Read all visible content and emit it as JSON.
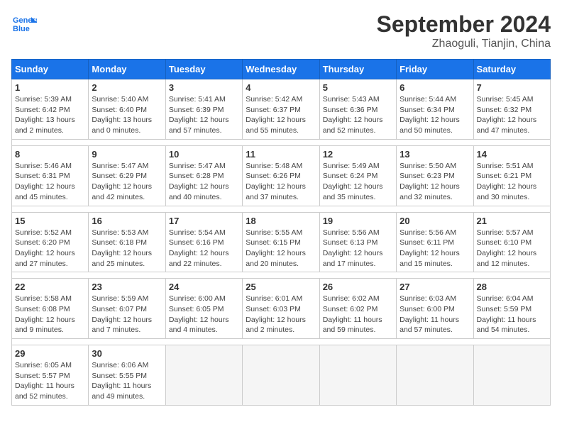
{
  "logo": {
    "line1": "General",
    "line2": "Blue"
  },
  "title": "September 2024",
  "subtitle": "Zhaoguli, Tianjin, China",
  "weekdays": [
    "Sunday",
    "Monday",
    "Tuesday",
    "Wednesday",
    "Thursday",
    "Friday",
    "Saturday"
  ],
  "weeks": [
    [
      {
        "day": "1",
        "rise": "5:39 AM",
        "set": "6:42 PM",
        "hours": "13 hours",
        "mins": "2 minutes"
      },
      {
        "day": "2",
        "rise": "5:40 AM",
        "set": "6:40 PM",
        "hours": "13 hours",
        "mins": "0 minutes"
      },
      {
        "day": "3",
        "rise": "5:41 AM",
        "set": "6:39 PM",
        "hours": "12 hours",
        "mins": "57 minutes"
      },
      {
        "day": "4",
        "rise": "5:42 AM",
        "set": "6:37 PM",
        "hours": "12 hours",
        "mins": "55 minutes"
      },
      {
        "day": "5",
        "rise": "5:43 AM",
        "set": "6:36 PM",
        "hours": "12 hours",
        "mins": "52 minutes"
      },
      {
        "day": "6",
        "rise": "5:44 AM",
        "set": "6:34 PM",
        "hours": "12 hours",
        "mins": "50 minutes"
      },
      {
        "day": "7",
        "rise": "5:45 AM",
        "set": "6:32 PM",
        "hours": "12 hours",
        "mins": "47 minutes"
      }
    ],
    [
      {
        "day": "8",
        "rise": "5:46 AM",
        "set": "6:31 PM",
        "hours": "12 hours",
        "mins": "45 minutes"
      },
      {
        "day": "9",
        "rise": "5:47 AM",
        "set": "6:29 PM",
        "hours": "12 hours",
        "mins": "42 minutes"
      },
      {
        "day": "10",
        "rise": "5:47 AM",
        "set": "6:28 PM",
        "hours": "12 hours",
        "mins": "40 minutes"
      },
      {
        "day": "11",
        "rise": "5:48 AM",
        "set": "6:26 PM",
        "hours": "12 hours",
        "mins": "37 minutes"
      },
      {
        "day": "12",
        "rise": "5:49 AM",
        "set": "6:24 PM",
        "hours": "12 hours",
        "mins": "35 minutes"
      },
      {
        "day": "13",
        "rise": "5:50 AM",
        "set": "6:23 PM",
        "hours": "12 hours",
        "mins": "32 minutes"
      },
      {
        "day": "14",
        "rise": "5:51 AM",
        "set": "6:21 PM",
        "hours": "12 hours",
        "mins": "30 minutes"
      }
    ],
    [
      {
        "day": "15",
        "rise": "5:52 AM",
        "set": "6:20 PM",
        "hours": "12 hours",
        "mins": "27 minutes"
      },
      {
        "day": "16",
        "rise": "5:53 AM",
        "set": "6:18 PM",
        "hours": "12 hours",
        "mins": "25 minutes"
      },
      {
        "day": "17",
        "rise": "5:54 AM",
        "set": "6:16 PM",
        "hours": "12 hours",
        "mins": "22 minutes"
      },
      {
        "day": "18",
        "rise": "5:55 AM",
        "set": "6:15 PM",
        "hours": "12 hours",
        "mins": "20 minutes"
      },
      {
        "day": "19",
        "rise": "5:56 AM",
        "set": "6:13 PM",
        "hours": "12 hours",
        "mins": "17 minutes"
      },
      {
        "day": "20",
        "rise": "5:56 AM",
        "set": "6:11 PM",
        "hours": "12 hours",
        "mins": "15 minutes"
      },
      {
        "day": "21",
        "rise": "5:57 AM",
        "set": "6:10 PM",
        "hours": "12 hours",
        "mins": "12 minutes"
      }
    ],
    [
      {
        "day": "22",
        "rise": "5:58 AM",
        "set": "6:08 PM",
        "hours": "12 hours",
        "mins": "9 minutes"
      },
      {
        "day": "23",
        "rise": "5:59 AM",
        "set": "6:07 PM",
        "hours": "12 hours",
        "mins": "7 minutes"
      },
      {
        "day": "24",
        "rise": "6:00 AM",
        "set": "6:05 PM",
        "hours": "12 hours",
        "mins": "4 minutes"
      },
      {
        "day": "25",
        "rise": "6:01 AM",
        "set": "6:03 PM",
        "hours": "12 hours",
        "mins": "2 minutes"
      },
      {
        "day": "26",
        "rise": "6:02 AM",
        "set": "6:02 PM",
        "hours": "11 hours",
        "mins": "59 minutes"
      },
      {
        "day": "27",
        "rise": "6:03 AM",
        "set": "6:00 PM",
        "hours": "11 hours",
        "mins": "57 minutes"
      },
      {
        "day": "28",
        "rise": "6:04 AM",
        "set": "5:59 PM",
        "hours": "11 hours",
        "mins": "54 minutes"
      }
    ],
    [
      {
        "day": "29",
        "rise": "6:05 AM",
        "set": "5:57 PM",
        "hours": "11 hours",
        "mins": "52 minutes"
      },
      {
        "day": "30",
        "rise": "6:06 AM",
        "set": "5:55 PM",
        "hours": "11 hours",
        "mins": "49 minutes"
      },
      null,
      null,
      null,
      null,
      null
    ]
  ],
  "labels": {
    "sunrise": "Sunrise:",
    "sunset": "Sunset:",
    "daylight": "Daylight:"
  },
  "colors": {
    "header_bg": "#1a73e8",
    "empty_bg": "#f5f5f5"
  }
}
